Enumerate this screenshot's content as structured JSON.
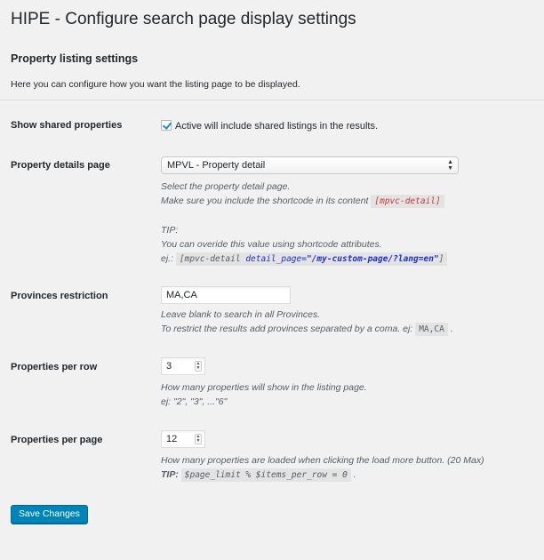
{
  "page": {
    "title": "HIPE - Configure search page display settings",
    "section_title": "Property listing settings",
    "intro": "Here you can configure how you want the listing page to be displayed."
  },
  "shared": {
    "label": "Show shared properties",
    "checked": true,
    "checkbox_text": "Active will include shared listings in the results."
  },
  "details": {
    "label": "Property details page",
    "selected": "MPVL - Property detail",
    "desc1": "Select the property detail page.",
    "desc2": "Make sure you include the shortcode in its content",
    "shortcode": "[mpvc-detail]",
    "tip_label": "TIP:",
    "tip_text": "You can overide this value using shortcode attributes.",
    "example_prefix": "ej.:",
    "example_part1": "[mpvc-detail",
    "example_part2": "detail_page=",
    "example_part3": "\"/my-custom-page/?lang=en\"",
    "example_part4": "]"
  },
  "provinces": {
    "label": "Provinces restriction",
    "value": "MA,CA",
    "desc1": "Leave blank to search in all Provinces.",
    "desc2": "To restrict the results add provinces separated by a coma. ej:",
    "example": "MA,CA",
    "trailing": "."
  },
  "per_row": {
    "label": "Properties per row",
    "value": "3",
    "desc1": "How many properties will show in the listing page.",
    "desc2": "ej: \"2\", \"3\", ...\"6\""
  },
  "per_page": {
    "label": "Properties per page",
    "value": "12",
    "desc1": "How many properties are loaded when clicking the load more button. (20 Max)",
    "tip_label": "TIP:",
    "formula": "$page_limit % $items_per_row = 0",
    "trailing": "."
  },
  "save_label": "Save Changes",
  "colors": {
    "primary_button": "#0085ba",
    "shortcode_red": "#cc3333",
    "code_blue": "#1d2ecc"
  }
}
